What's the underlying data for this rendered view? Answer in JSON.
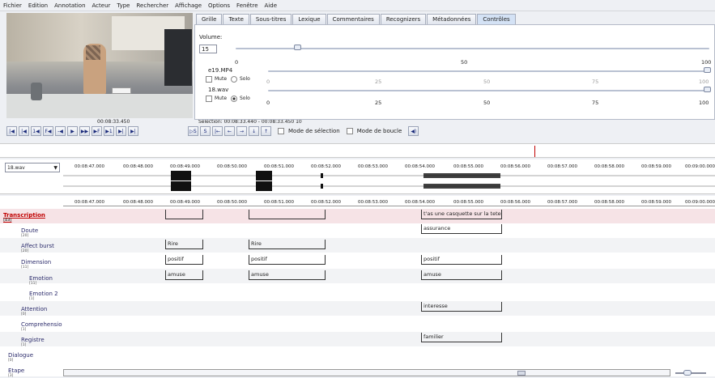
{
  "menu": [
    "Fichier",
    "Edition",
    "Annotation",
    "Acteur",
    "Type",
    "Rechercher",
    "Affichage",
    "Options",
    "Fenêtre",
    "Aide"
  ],
  "tabs": [
    "Grille",
    "Texte",
    "Sous-titres",
    "Lexique",
    "Commentaires",
    "Recognizers",
    "Métadonnées",
    "Contrôles"
  ],
  "active_tab": "Contrôles",
  "volume": {
    "label": "Volume:",
    "value": "15",
    "min": "0",
    "mid": "50",
    "max": "100"
  },
  "media": [
    {
      "name": "e19.MP4",
      "mute_label": "Mute",
      "solo_label": "Solo",
      "ticks": [
        "0",
        "25",
        "50",
        "75",
        "100"
      ]
    },
    {
      "name": "18.wav",
      "mute_label": "Mute",
      "solo_label": "Solo",
      "ticks": [
        "0",
        "25",
        "50",
        "75",
        "100"
      ]
    }
  ],
  "video_time": "00:08:33.450",
  "selection": "Sélection: 00:08:33.440 - 00:08:33.450  10",
  "mode_selection": "Mode de sélection",
  "mode_boucle": "Mode de boucle",
  "wave_select": "18.wav",
  "time_labels": [
    "00:08:47.000",
    "00:08:48.000",
    "00:08:49.000",
    "00:08:50.000",
    "00:08:51.000",
    "00:08:52.000",
    "00:08:53.000",
    "00:08:54.000",
    "00:08:55.000",
    "00:08:56.000",
    "00:08:57.000",
    "00:08:58.000",
    "00:08:59.000",
    "00:09:00.000"
  ],
  "tiers": [
    {
      "name": "Transcription",
      "count": "[43]"
    },
    {
      "name": "Doute",
      "count": "[20]"
    },
    {
      "name": "Affect burst",
      "count": "[20]"
    },
    {
      "name": "Dimension",
      "count": "[11]"
    },
    {
      "name": "Emotion",
      "count": "[11]"
    },
    {
      "name": "Emotion 2",
      "count": "[1]"
    },
    {
      "name": "Attention",
      "count": "[0]"
    },
    {
      "name": "Comprehensio",
      "count": "[1]"
    },
    {
      "name": "Registre",
      "count": "[1]"
    },
    {
      "name": "Dialogue",
      "count": "[0]"
    },
    {
      "name": "Etape",
      "count": "[3]"
    }
  ],
  "annotations": {
    "transcription": "t'as une casquette sur la tete",
    "doute": "assurance",
    "affect1": "Rire",
    "affect2": "Rire",
    "dim1": "positif",
    "dim2": "positif",
    "dim3": "positif",
    "emo1": "amuse",
    "emo2": "amuse",
    "emo3": "amuse",
    "attention": "interesse",
    "registre": "familier"
  },
  "colors": {
    "accent": "#c00000",
    "tier_text": "#2a2a6a",
    "selected_row": "#f6e3e6"
  }
}
